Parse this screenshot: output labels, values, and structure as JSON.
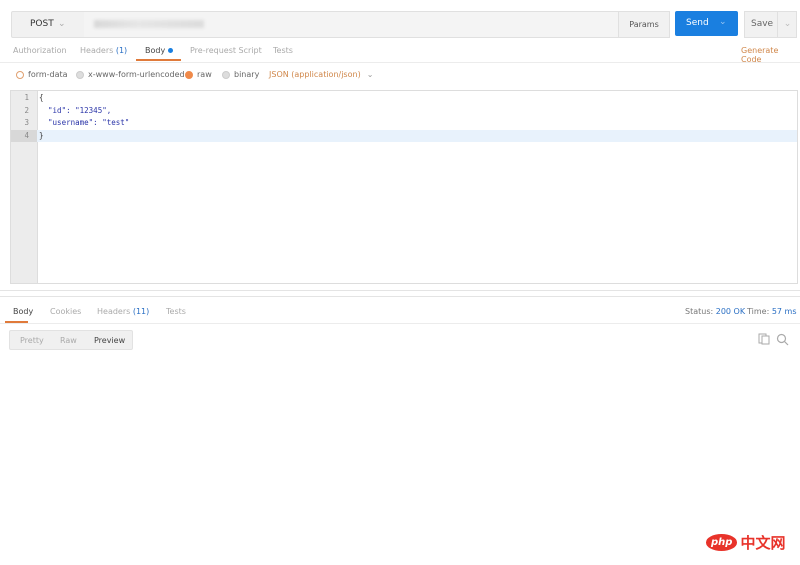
{
  "request": {
    "method": "POST",
    "params_label": "Params",
    "send_label": "Send",
    "save_label": "Save"
  },
  "request_tabs": [
    {
      "label": "Authorization"
    },
    {
      "label": "Headers",
      "count": "(1)"
    },
    {
      "label": "Body"
    },
    {
      "label": "Pre-request Script"
    },
    {
      "label": "Tests"
    }
  ],
  "generate_code": "Generate Code",
  "body_options": {
    "form_data": "form-data",
    "urlencoded": "x-www-form-urlencoded",
    "raw": "raw",
    "binary": "binary",
    "content_type": "JSON (application/json)"
  },
  "editor": {
    "line_numbers": [
      "1",
      "2",
      "3",
      "4"
    ],
    "lines": [
      "{",
      "  \"id\": \"12345\",",
      "  \"username\": \"test\"",
      "}"
    ]
  },
  "response": {
    "tabs": [
      {
        "label": "Body"
      },
      {
        "label": "Cookies"
      },
      {
        "label": "Headers",
        "count": "(11)"
      },
      {
        "label": "Tests"
      }
    ],
    "status_label": "Status:",
    "status_value": "200 OK",
    "time_label": "Time:",
    "time_value": "57 ms",
    "formats": [
      "Pretty",
      "Raw",
      "Preview"
    ]
  },
  "watermark": "php中文网",
  "colors": {
    "accent": "#e07a3a",
    "send": "#1a7fe0",
    "link": "#2a6fc4"
  }
}
